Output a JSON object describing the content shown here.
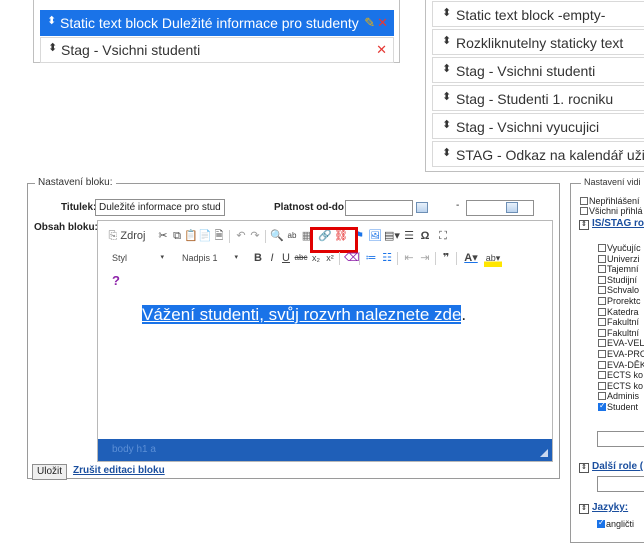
{
  "left_list": {
    "items": [
      {
        "label": "Static text block Duležité informace pro studenty",
        "selected": true
      },
      {
        "label": "Stag - Vsichni studenti",
        "selected": false
      }
    ]
  },
  "right_list": {
    "items": [
      "Static text block -empty-",
      "Rozkliknutelny staticky text",
      "Stag - Vsichni studenti",
      "Stag - Studenti 1. rocniku",
      "Stag - Vsichni vyucujici",
      "STAG - Odkaz na kalendář uživa"
    ]
  },
  "settings": {
    "legend": "Nastavení bloku:",
    "title_label": "Titulek:",
    "title_value": "Duležité informace pro stud",
    "validity_label": "Platnost od-do:",
    "date_dash": "-",
    "content_label": "Obsah bloku:",
    "save_label": "Uložit",
    "cancel_label": "Zrušit editaci bloku"
  },
  "editor": {
    "source_label": "Zdroj",
    "style_value": "Styl",
    "format_value": "Nadpis 1",
    "help_glyph": "?",
    "content_highlighted": "Vážení studenti, svůj rozvrh naleznete zde",
    "content_tail": ".",
    "status_path": "body  h1  a",
    "highlight_color": "#e00000",
    "accent": "#1a73e8"
  },
  "visibility": {
    "legend": "Nastavení vidi",
    "not_logged": "Nepřihlášení",
    "all_logged": "Všichni přihlá",
    "isstag_link": "IS/STAG ro",
    "roles": [
      {
        "label": "Vyučujíc",
        "checked": false
      },
      {
        "label": "Univerzi",
        "checked": false
      },
      {
        "label": "Tajemní",
        "checked": false
      },
      {
        "label": "Studijní",
        "checked": false
      },
      {
        "label": "Schvalo",
        "checked": false
      },
      {
        "label": "Prorektc",
        "checked": false
      },
      {
        "label": "Katedra",
        "checked": false
      },
      {
        "label": "Fakultní",
        "checked": false
      },
      {
        "label": "Fakultní",
        "checked": false
      },
      {
        "label": "EVA-VEL",
        "checked": false
      },
      {
        "label": "EVA-PRO",
        "checked": false
      },
      {
        "label": "EVA-DĚK",
        "checked": false
      },
      {
        "label": "ECTS ko",
        "checked": false
      },
      {
        "label": "ECTS ko",
        "checked": false
      },
      {
        "label": "Adminis",
        "checked": false
      },
      {
        "label": "Student",
        "checked": true
      }
    ],
    "other_roles_link": "Další role (",
    "languages_link": "Jazyky:",
    "lang_first": "angličti"
  }
}
